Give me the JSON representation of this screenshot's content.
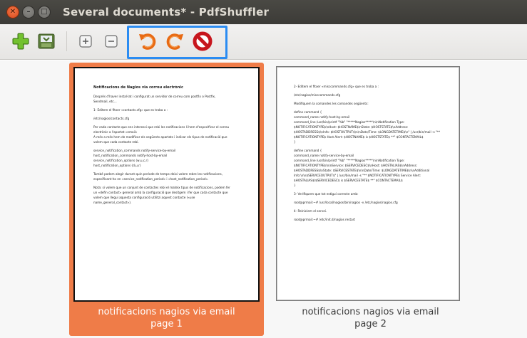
{
  "window": {
    "title": "Several documents* - PdfShuffler",
    "close_glyph": "✕",
    "min_glyph": "–",
    "max_glyph": "□"
  },
  "toolbar": {
    "items": [
      {
        "name": "import-pdf-button",
        "icon": "green-plus-icon"
      },
      {
        "name": "export-pdf-button",
        "icon": "save-icon"
      },
      {
        "name": "zoom-in-button",
        "icon": "zoom-in-icon",
        "glyph": "+"
      },
      {
        "name": "zoom-out-button",
        "icon": "zoom-out-icon",
        "glyph": "−"
      },
      {
        "name": "rotate-left-button",
        "icon": "rotate-counterclockwise-icon"
      },
      {
        "name": "rotate-right-button",
        "icon": "rotate-clockwise-icon"
      },
      {
        "name": "delete-button",
        "icon": "delete-icon"
      }
    ],
    "accent_color": "#2b8cf2"
  },
  "pages": [
    {
      "caption_line1": "notificacions nagios via email",
      "caption_line2": "page 1",
      "selected": true,
      "doc_lines": [
        {
          "t": "Notificacions de Nagios via correu electrònic",
          "h": true
        },
        {
          "t": "",
          "gap": true
        },
        {
          "t": "Després d'haver instal·lat i configurat un servidor de correu com postfix o Postfix,"
        },
        {
          "t": "Sendmail, etc..."
        },
        {
          "t": "",
          "gap": true
        },
        {
          "t": "1- Editem el fitxer «contacts.cfg» que es troba a :"
        },
        {
          "t": "",
          "gap": true
        },
        {
          "t": "/etc/nagios/contacts.cfg"
        },
        {
          "t": "",
          "gap": true
        },
        {
          "t": "Per cada contacte que ens interessi que rebi les notificacions li hem d'especificar el correu"
        },
        {
          "t": "electrònic a l'apartat «email»"
        },
        {
          "t": "A més a més hem de modificar els següents apartats i indicar els tipus de notificació que"
        },
        {
          "t": "volem que cada contacte rebi."
        },
        {
          "t": "",
          "gap": true
        },
        {
          "t": "service_notification_commands        notify-service-by-email"
        },
        {
          "t": "host_notification_commands        notify-host-by-email"
        },
        {
          "t": "service_notification_options                 (w,u,c,r)"
        },
        {
          "t": "host_notification_options                       (d,u,r)"
        },
        {
          "t": "",
          "gap": true
        },
        {
          "t": "També podem alegir durant quin període de temps deixi volem rebre les notificacions,"
        },
        {
          "t": "especificant-ho en «service_notification_period» i «host_notification_period»."
        },
        {
          "t": "",
          "gap": true
        },
        {
          "t": "Nota: si volem que un conjunt de contactes rebi el mateix tipus de notificacions, podem fer"
        },
        {
          "t": "un «defin contact» general amb la configuració que desitgem i fer que cada contacte que"
        },
        {
          "t": "volem que llegui aquesta configuració utilitzi aquest contacte («use"
        },
        {
          "t": "name_general_contact»)."
        }
      ]
    },
    {
      "caption_line1": "notificacions nagios via email",
      "caption_line2": "page 2",
      "selected": false,
      "doc_lines": [
        {
          "t": "2- Editem el fitxer «misccommands.cfg» que es troba a :"
        },
        {
          "t": "",
          "gap": true
        },
        {
          "t": "/etc/nagios/misccommands.cfg"
        },
        {
          "t": "",
          "gap": true
        },
        {
          "t": "Modifiquem la comandes les comandes següents:"
        },
        {
          "t": "",
          "gap": true
        },
        {
          "t": "define command {"
        },
        {
          "t": "        command_name        notify-host-by-email"
        },
        {
          "t": "        command_line        /usr/bin/printf \"%b\" \"*****Nagios*****\\n\\nNotification Type:"
        },
        {
          "t": "$NOTIFICATIONTYPE$\\nHost: $HOSTNAME$\\nState: $HOSTSTATE$\\nAddress:"
        },
        {
          "t": "$HOSTADDRESS$\\nInfo: $HOSTOUTPUT$\\n\\nDate/Time: $LONGDATETIME$\\n\" | /usr/bin/mail -s \"**"
        },
        {
          "t": "$NOTIFICATIONTYPE$ Host Alert: $HOSTNAME$ is $HOSTSTATE$ **\" $CONTACTEMAIL$"
        },
        {
          "t": "}"
        },
        {
          "t": "",
          "gap": true
        },
        {
          "t": "define command {"
        },
        {
          "t": "        command_name        notify-service-by-email"
        },
        {
          "t": "        command_line        /usr/bin/printf \"%b\" \"*****Nagios*****\\n\\nNotification Type:"
        },
        {
          "t": "$NOTIFICATIONTYPE$\\n\\nService: $SERVICEDESC$\\nHost: $HOSTALIAS$\\nAddress:"
        },
        {
          "t": "$HOSTADDRESS$\\nState: $SERVICESTATE$\\n\\nDate/Time: $LONGDATETIME$\\n\\nAdditional"
        },
        {
          "t": "Info:\\n\\n$SERVICEOUTPUT$\" | /usr/bin/mail -s \"** $NOTIFICATIONTYPE$ Service Alert:"
        },
        {
          "t": "$HOSTALIAS$/$SERVICEDESC$ is $SERVICESTATE$ **\" $CONTACTEMAIL$"
        },
        {
          "t": "}"
        },
        {
          "t": "",
          "gap": true
        },
        {
          "t": "3- Verifiquem que tot estigui correcte amb:"
        },
        {
          "t": "",
          "gap": true
        },
        {
          "t": "root@prmail:~# /usr/local/nagios/bin/nagios -v /etc/nagios/nagios.cfg"
        },
        {
          "t": "",
          "gap": true
        },
        {
          "t": "4- Reiniciem el servei."
        },
        {
          "t": "",
          "gap": true
        },
        {
          "t": "root@prmail:~# /etc/init.d/nagios restart"
        }
      ]
    }
  ]
}
